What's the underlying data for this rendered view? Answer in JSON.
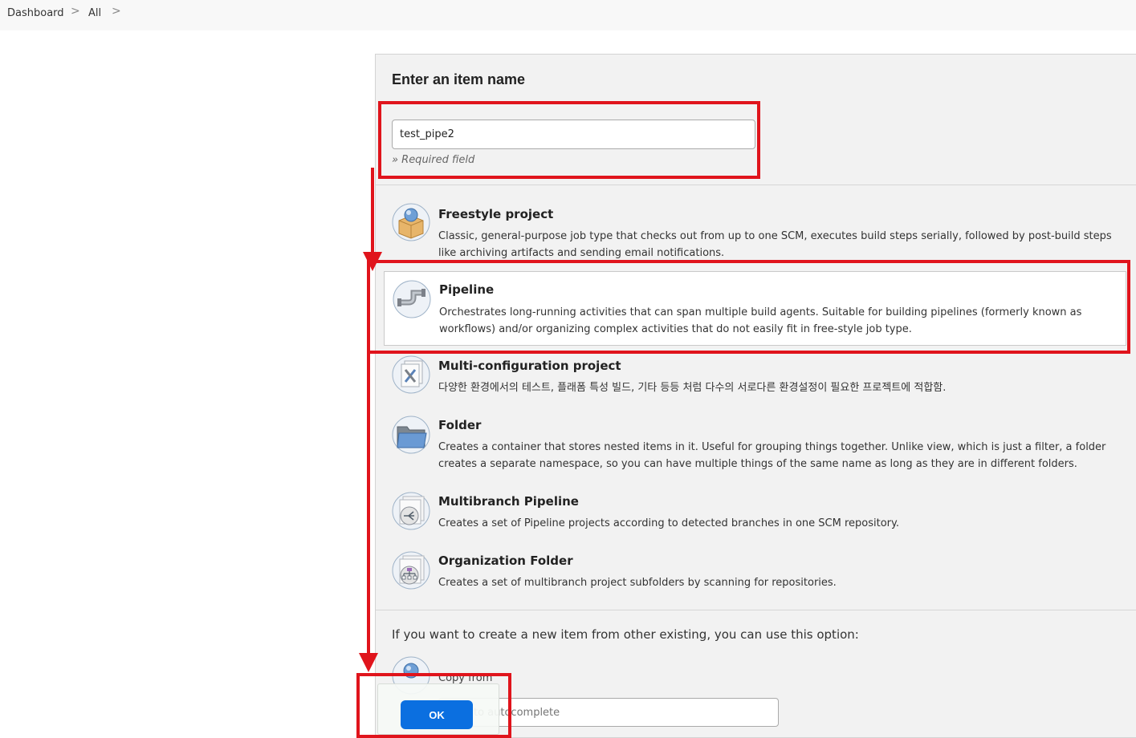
{
  "breadcrumb": {
    "items": [
      {
        "label": "Dashboard"
      },
      {
        "label": "All"
      }
    ],
    "separator": ">"
  },
  "form": {
    "title": "Enter an item name",
    "name_value": "test_pipe2",
    "required_note": "» Required field"
  },
  "item_types": [
    {
      "title": "Freestyle project",
      "description": "Classic, general-purpose job type that checks out from up to one SCM, executes build steps serially, followed by post-build steps like archiving artifacts and sending email notifications.",
      "icon": "freestyle-project-icon",
      "selected": false
    },
    {
      "title": "Pipeline",
      "description": "Orchestrates long-running activities that can span multiple build agents. Suitable for building pipelines (formerly known as workflows) and/or organizing complex activities that do not easily fit in free-style job type.",
      "icon": "pipeline-icon",
      "selected": true
    },
    {
      "title": "Multi-configuration project",
      "description": "다양한 환경에서의 테스트, 플래폼 특성 빌드, 기타 등등 처럼 다수의 서로다른 환경설정이 필요한 프로젝트에 적합함.",
      "icon": "multi-configuration-icon",
      "selected": false
    },
    {
      "title": "Folder",
      "description": "Creates a container that stores nested items in it. Useful for grouping things together. Unlike view, which is just a filter, a folder creates a separate namespace, so you can have multiple things of the same name as long as they are in different folders.",
      "icon": "folder-icon",
      "selected": false
    },
    {
      "title": "Multibranch Pipeline",
      "description": "Creates a set of Pipeline projects according to detected branches in one SCM repository.",
      "icon": "multibranch-pipeline-icon",
      "selected": false
    },
    {
      "title": "Organization Folder",
      "description": "Creates a set of multibranch project subfolders by scanning for repositories.",
      "icon": "organization-folder-icon",
      "selected": false
    }
  ],
  "copy": {
    "heading": "If you want to create a new item from other existing, you can use this option:",
    "label": "Copy from",
    "placeholder": "Type to autocomplete"
  },
  "ok_button": {
    "label": "OK"
  },
  "colors": {
    "annotation": "#e0141c",
    "ok_button": "#0b6fe0",
    "panel_background": "#f2f2f2"
  }
}
